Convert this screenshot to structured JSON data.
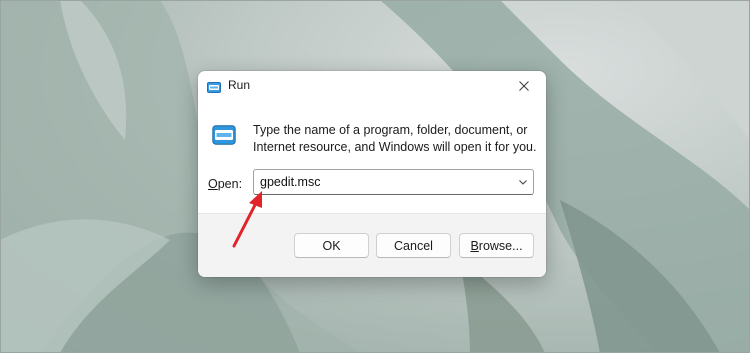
{
  "window": {
    "title": "Run",
    "description": "Type the name of a program, folder, document, or Internet resource, and Windows will open it for you.",
    "open_label_underlined": "O",
    "open_label_rest": "pen:",
    "open_value": "gpedit.msc",
    "buttons": {
      "ok": "OK",
      "cancel": "Cancel",
      "browse_underlined": "B",
      "browse_rest": "rowse..."
    }
  },
  "icons": {
    "title_icon": "run-icon",
    "close_icon": "close-icon",
    "dropdown_icon": "chevron-down-icon",
    "annotation": "red-arrow"
  },
  "colors": {
    "accent": "#2a8fd6",
    "annotation": "#e0242a"
  }
}
